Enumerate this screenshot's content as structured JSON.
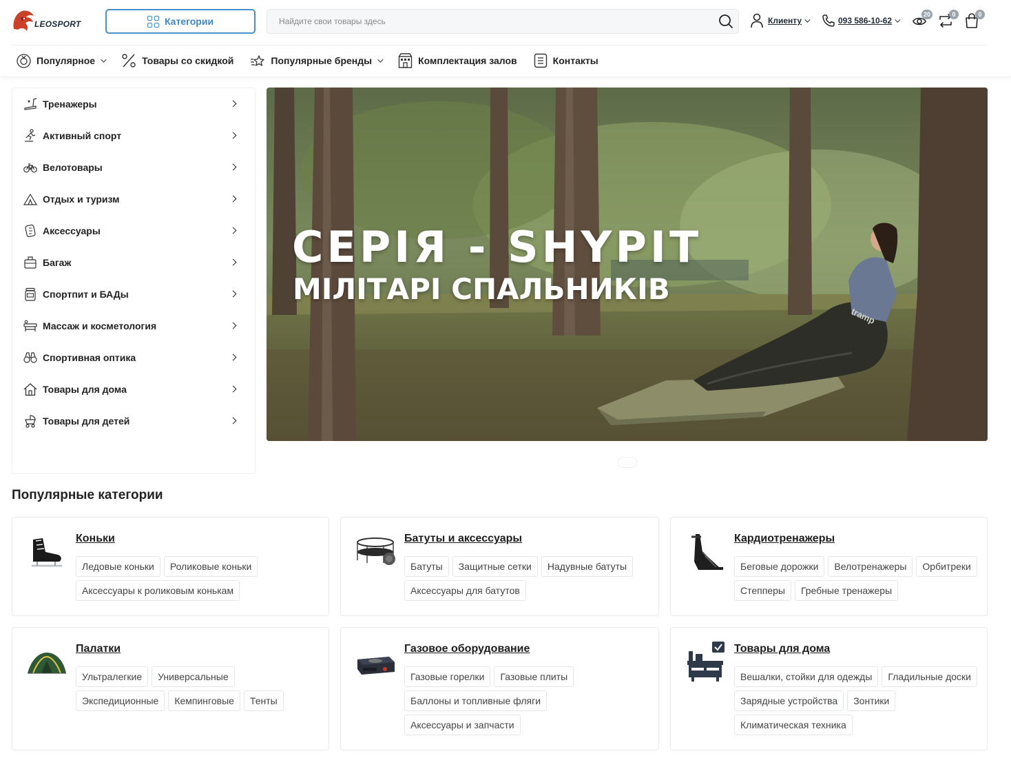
{
  "brand": {
    "logo_text": "LEOSPORT"
  },
  "header": {
    "categories_button": "Категории",
    "search_placeholder": "Найдите свои товары здесь",
    "account_label": "Клиенту",
    "phone": "093 586-10-62",
    "badges": {
      "compare": "20",
      "wishlist": "0",
      "cart": "0"
    }
  },
  "nav": {
    "items": [
      {
        "label": "Популярное",
        "icon": "medal-icon",
        "dropdown": true
      },
      {
        "label": "Товары со скидкой",
        "icon": "percent-icon",
        "dropdown": false
      },
      {
        "label": "Популярные бренды",
        "icon": "stars-icon",
        "dropdown": true
      },
      {
        "label": "Комплектация залов",
        "icon": "building-icon",
        "dropdown": false
      },
      {
        "label": "Контакты",
        "icon": "list-icon",
        "dropdown": false
      }
    ]
  },
  "sidebar": {
    "items": [
      {
        "label": "Тренажеры",
        "icon": "treadmill-icon"
      },
      {
        "label": "Активный спорт",
        "icon": "skater-icon"
      },
      {
        "label": "Велотовары",
        "icon": "bicycle-icon"
      },
      {
        "label": "Отдых и туризм",
        "icon": "tent-icon"
      },
      {
        "label": "Аксессуары",
        "icon": "glove-icon"
      },
      {
        "label": "Багаж",
        "icon": "suitcase-icon"
      },
      {
        "label": "Спортпит и БАДы",
        "icon": "jar-icon"
      },
      {
        "label": "Массаж и косметология",
        "icon": "massage-table-icon"
      },
      {
        "label": "Спортивная оптика",
        "icon": "binoculars-icon"
      },
      {
        "label": "Товары для дома",
        "icon": "house-icon"
      },
      {
        "label": "Товары для детей",
        "icon": "stroller-icon"
      }
    ]
  },
  "banner": {
    "title": "СЕРІЯ - SHYPIT",
    "subtitle": "МІЛІТАРІ СПАЛЬНИКІВ",
    "bag_text": "tramp"
  },
  "popular": {
    "title": "Популярные категории",
    "cards": [
      {
        "title": "Коньки",
        "icon": "ice-skate-icon",
        "tags": [
          "Ледовые коньки",
          "Роликовые коньки",
          "Аксессуары к роликовым конькам"
        ]
      },
      {
        "title": "Батуты и аксессуары",
        "icon": "trampoline-icon",
        "tags": [
          "Батуты",
          "Защитные сетки",
          "Надувные батуты",
          "Аксессуары для батутов"
        ]
      },
      {
        "title": "Кардиотренажеры",
        "icon": "stepper-machine-icon",
        "tags": [
          "Беговые дорожки",
          "Велотренажеры",
          "Орбитреки",
          "Степперы",
          "Гребные тренажеры"
        ]
      },
      {
        "title": "Палатки",
        "icon": "dome-tent-icon",
        "tags": [
          "Ультралегкие",
          "Универсальные",
          "Экспедиционные",
          "Кемпинговые",
          "Тенты"
        ]
      },
      {
        "title": "Газовое оборудование",
        "icon": "gas-stove-icon",
        "tags": [
          "Газовые горелки",
          "Газовые плиты",
          "Баллоны и топливные фляги",
          "Аксессуары и запчасти"
        ]
      },
      {
        "title": "Товары для дома",
        "icon": "home-office-icon",
        "tags": [
          "Вешалки, стойки для одежды",
          "Гладильные доски",
          "Зарядные устройства",
          "Зонтики",
          "Климатическая техника"
        ]
      }
    ]
  }
}
